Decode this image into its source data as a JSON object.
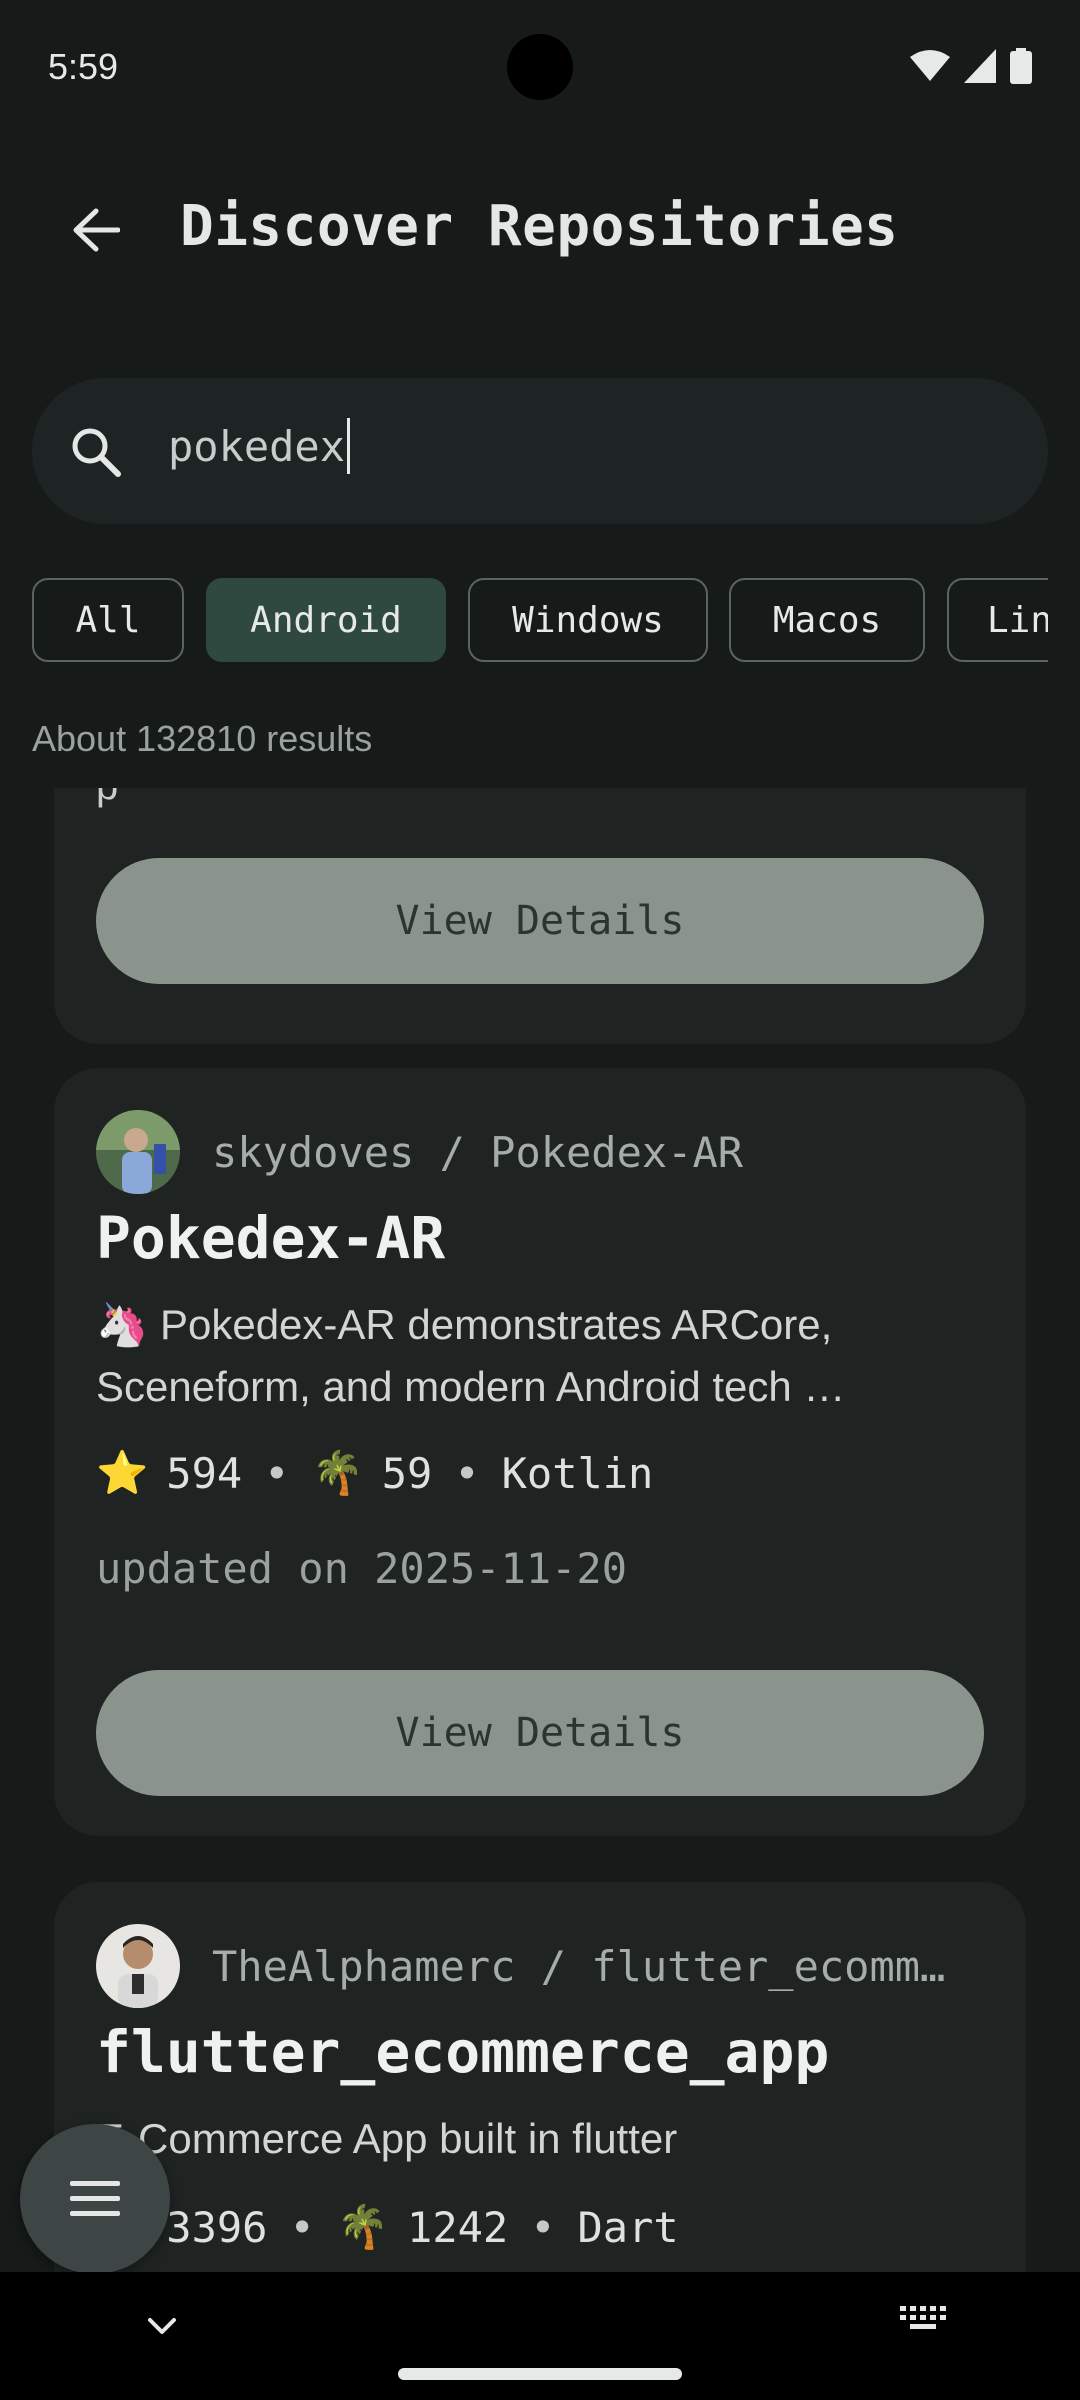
{
  "status_bar": {
    "time": "5:59"
  },
  "app_bar": {
    "title": "Discover Repositories"
  },
  "search": {
    "value": "pokedex"
  },
  "filters": {
    "chips": [
      "All",
      "Android",
      "Windows",
      "Macos",
      "Linux"
    ],
    "selected": "Android"
  },
  "results": {
    "count_text": "About 132810 results"
  },
  "repos": [
    {
      "partial_text": "p",
      "button_label": "View Details"
    },
    {
      "owner": "skydoves",
      "name_slug": "Pokedex-AR",
      "title": "Pokedex-AR",
      "desc_line1": "🦄 Pokedex-AR demonstrates ARCore,",
      "desc_line2": "Sceneform, and modern Android tech …",
      "star_icon": "⭐",
      "stars": "594",
      "fork_icon": "🌴",
      "forks": "59",
      "language": "Kotlin",
      "updated": "updated on 2025-11-20",
      "button_label": "View Details"
    },
    {
      "owner": "TheAlphamerc",
      "name_slug": "flutter_ecomm…",
      "title": "flutter_ecommerce_app",
      "desc_line1": "E-Commerce App built in flutter",
      "star_icon": "⭐",
      "stars": "3396",
      "fork_icon": "🌴",
      "forks": "1242",
      "language": "Dart"
    }
  ],
  "colors": {
    "background": "#161a19",
    "card": "#1f2423",
    "selected_chip": "#2f4840",
    "button": "#8a948d"
  }
}
